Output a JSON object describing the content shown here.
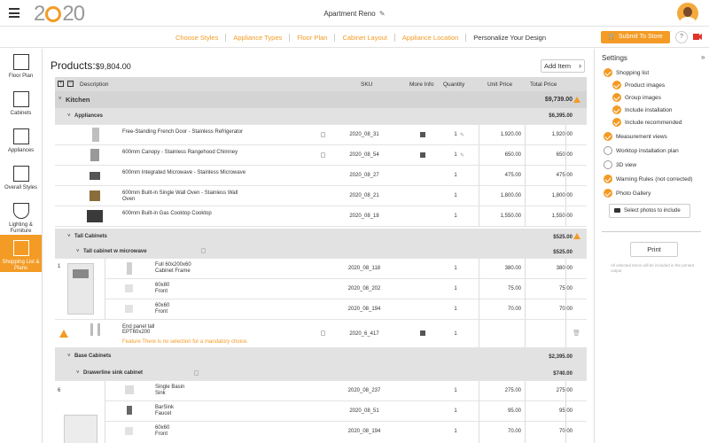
{
  "header": {
    "logo": "2020",
    "project_title": "Apartment Reno",
    "edit_glyph": "✎"
  },
  "steps": [
    "Choose Styles",
    "Appliance Types",
    "Floor Plan",
    "Cabinet Layout",
    "Appliance Location",
    "Personalize Your Design"
  ],
  "submit_label": "Submit To Store",
  "help_label": "?",
  "nav": [
    {
      "label": "Floor Plan",
      "icon": "floor-plan-icon"
    },
    {
      "label": "Cabinets",
      "icon": "cabinets-icon"
    },
    {
      "label": "Appliances",
      "icon": "appliances-icon"
    },
    {
      "label": "Overall Styles",
      "icon": "overall-styles-icon"
    },
    {
      "label": "Lighting & Furniture",
      "icon": "lighting-icon"
    },
    {
      "label": "Shopping List & Plans",
      "icon": "shopping-list-icon"
    }
  ],
  "products": {
    "label": "Products:",
    "total": "$9,804.00",
    "add_item": "Add Item"
  },
  "table": {
    "headers": [
      "Description",
      "SKU",
      "More Info",
      "Quantity",
      "Unit Price",
      "Total Price"
    ],
    "kitchen": {
      "name": "Kitchen",
      "total": "$9,739.00"
    },
    "appliances": {
      "name": "Appliances",
      "total": "$6,395.00"
    },
    "appliance_rows": [
      {
        "desc": "Free-Standing French Door - Stainless Refrigerator",
        "sku": "2020_08_31",
        "qty": "1",
        "unit": "1,920.00",
        "total": "1,920.00"
      },
      {
        "desc": "600mm Canopy - Stainless Rangehood Chimney",
        "sku": "2020_08_54",
        "qty": "1",
        "unit": "650.00",
        "total": "650.00"
      },
      {
        "desc": "600mm Integrated Microwave - Stainless Microwave",
        "sku": "2020_08_27",
        "qty": "1",
        "unit": "475.00",
        "total": "475.00"
      },
      {
        "desc": "600mm Built-in Single Wall Oven - Stainless Wall Oven",
        "sku": "2020_08_21",
        "qty": "1",
        "unit": "1,800.00",
        "total": "1,800.00"
      },
      {
        "desc": "600mm Built-in Gas Cooktop Cooktop",
        "sku": "2020_08_18",
        "qty": "1",
        "unit": "1,550.00",
        "total": "1,550.00"
      }
    ],
    "tall": {
      "name": "Tall Cabinets",
      "total": "$525.00"
    },
    "tall_sub": {
      "name": "Tall cabinet w microwave",
      "total": "$525.00"
    },
    "tall_group_qty": "1",
    "tall_rows": [
      {
        "desc1": "Full 60x200x60",
        "desc2": "Cabinet Frame",
        "sku": "2020_08_118",
        "qty": "1",
        "unit": "380.00",
        "total": "380.00"
      },
      {
        "desc1": "60x80",
        "desc2": "Front",
        "sku": "2020_08_202",
        "qty": "1",
        "unit": "75.00",
        "total": "75.00"
      },
      {
        "desc1": "60x60",
        "desc2": "Front",
        "sku": "2020_08_194",
        "qty": "1",
        "unit": "70.00",
        "total": "70.00"
      }
    ],
    "end_panel": {
      "desc1": "End panel tall",
      "desc2": "EPT60x200",
      "warning": "Feature There is no selection for a mandatory choice.",
      "sku": "2020_6_417",
      "qty": "1"
    },
    "base": {
      "name": "Base Cabinets",
      "total": "$2,395.00"
    },
    "base_sub": {
      "name": "Drawerline sink cabinet",
      "total": "$740.00"
    },
    "base_group_qty": "6",
    "base_rows": [
      {
        "desc1": "Single Basin",
        "desc2": "Sink",
        "sku": "2020_08_237",
        "qty": "1",
        "unit": "275.00",
        "total": "275.00"
      },
      {
        "desc1": "BarSink",
        "desc2": "Faucet",
        "sku": "2020_08_51",
        "qty": "1",
        "unit": "95.00",
        "total": "95.00"
      },
      {
        "desc1": "60x60",
        "desc2": "Front",
        "sku": "2020_08_194",
        "qty": "1",
        "unit": "70.00",
        "total": "70.00"
      }
    ]
  },
  "settings": {
    "title": "Settings",
    "options": [
      {
        "label": "Shopping list",
        "on": true,
        "indent": false
      },
      {
        "label": "Product images",
        "on": true,
        "indent": true
      },
      {
        "label": "Group images",
        "on": true,
        "indent": true
      },
      {
        "label": "Include installation",
        "on": true,
        "indent": true
      },
      {
        "label": "Include recommended",
        "on": true,
        "indent": true
      },
      {
        "label": "Measurement views",
        "on": true,
        "indent": false
      },
      {
        "label": "Worktop installation plan",
        "on": false,
        "indent": false
      },
      {
        "label": "3D view",
        "on": false,
        "indent": false
      },
      {
        "label": "Warning Rules (not corrected)",
        "on": true,
        "indent": false
      },
      {
        "label": "Photo Gallery",
        "on": true,
        "indent": false
      }
    ],
    "select_photos": "Select photos to include",
    "print": "Print",
    "note": "All selected items will be included in the printed output"
  },
  "colors": {
    "accent": "#f39b25",
    "header_gray": "#dcdcdc"
  }
}
